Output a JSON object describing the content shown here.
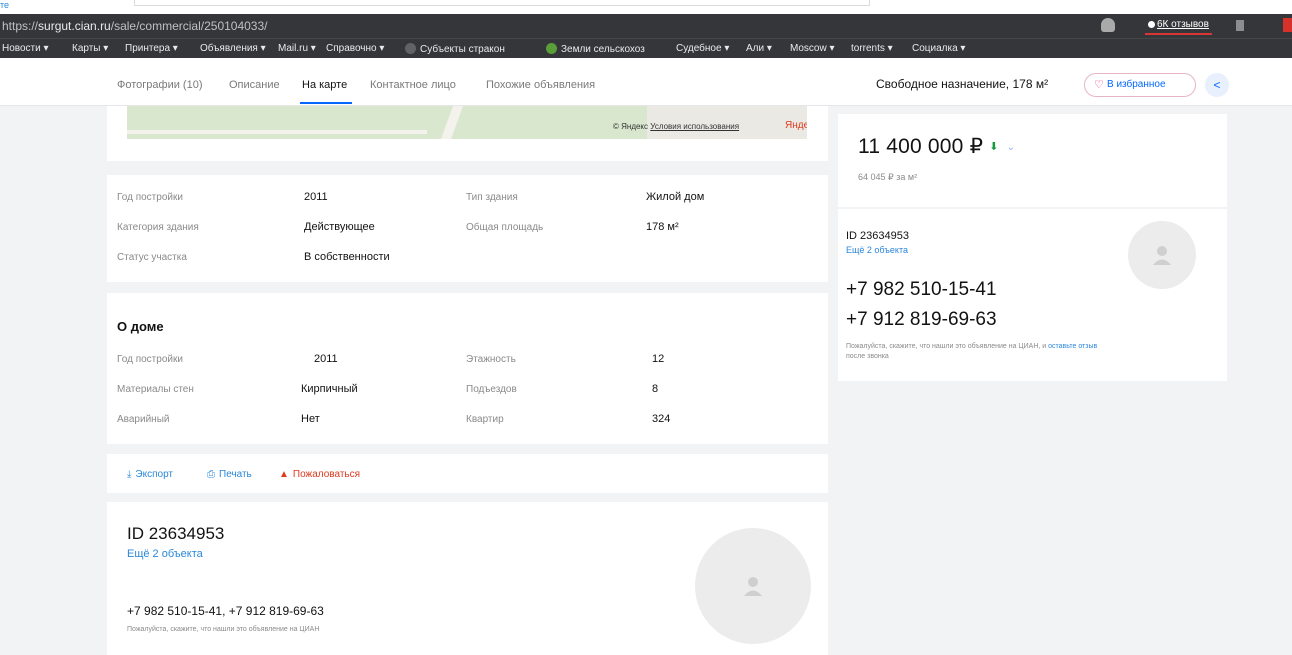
{
  "corner_label": "те",
  "browser": {
    "url_prefix": "https://",
    "url_host": "surgut.cian.ru",
    "url_path": "/sale/commercial/250104033/",
    "reviews_label": "6К отзывов",
    "bookmarks": [
      "Новости ▾",
      "Карты ▾",
      "Принтера ▾",
      "Объявления ▾",
      "Mail.ru ▾",
      "Справочно ▾",
      "Субъекты стракон",
      "Земли сельскохоз",
      "Судебное ▾",
      "Али ▾",
      "Moscow ▾",
      "torrents ▾",
      "Социалка ▾"
    ]
  },
  "nav": {
    "tabs": [
      "Фотографии (10)",
      "Описание",
      "На карте",
      "Контактное лицо",
      "Похожие объявления"
    ],
    "active_tab": "На карте",
    "title": "Свободное назначение, 178 м²",
    "favorite_label": "В избранное"
  },
  "map": {
    "copyright": "© Яндекс",
    "terms_link": "Условия использования",
    "logo": "Яндекс"
  },
  "building": {
    "rows": [
      {
        "k1": "Год постройки",
        "v1": "2011",
        "k2": "Тип здания",
        "v2": "Жилой дом"
      },
      {
        "k1": "Категория здания",
        "v1": "Действующее",
        "k2": "Общая площадь",
        "v2": "178 м²"
      },
      {
        "k1": "Статус участка",
        "v1": "В собственности",
        "k2": "",
        "v2": ""
      }
    ]
  },
  "house": {
    "title": "О доме",
    "rows": [
      {
        "k1": "Год постройки",
        "v1": "2011",
        "k2": "Этажность",
        "v2": "12"
      },
      {
        "k1": "Материалы стен",
        "v1": "Кирпичный",
        "k2": "Подъездов",
        "v2": "8"
      },
      {
        "k1": "Аварийный",
        "v1": "Нет",
        "k2": "Квартир",
        "v2": "324"
      }
    ]
  },
  "actions": {
    "export": "Экспорт",
    "print": "Печать",
    "report": "Пожаловаться"
  },
  "agent": {
    "id": "ID 23634953",
    "more": "Ещё 2 объекта",
    "phones": "+7 982 510-15-41, +7 912 819-69-63",
    "note": "Пожалуйста, скажите, что нашли это объявление на ЦИАН"
  },
  "sidebar": {
    "price": "11 400 000 ₽",
    "price_per_m": "64 045 ₽ за м²",
    "contact_id": "ID 23634953",
    "contact_more": "Ещё 2 объекта",
    "phone1": "+7 982 510-15-41",
    "phone2": "+7 912 819-69-63",
    "note_text": "Пожалуйста, скажите, что нашли это объявление на ЦИАН, и",
    "note_link": "оставьте отзыв",
    "note_tail": "после звонка"
  },
  "colors": {
    "accent": "#0468ff",
    "link": "#2b87db",
    "alert": "#e0391d",
    "price_down": "#1a9b3e"
  }
}
